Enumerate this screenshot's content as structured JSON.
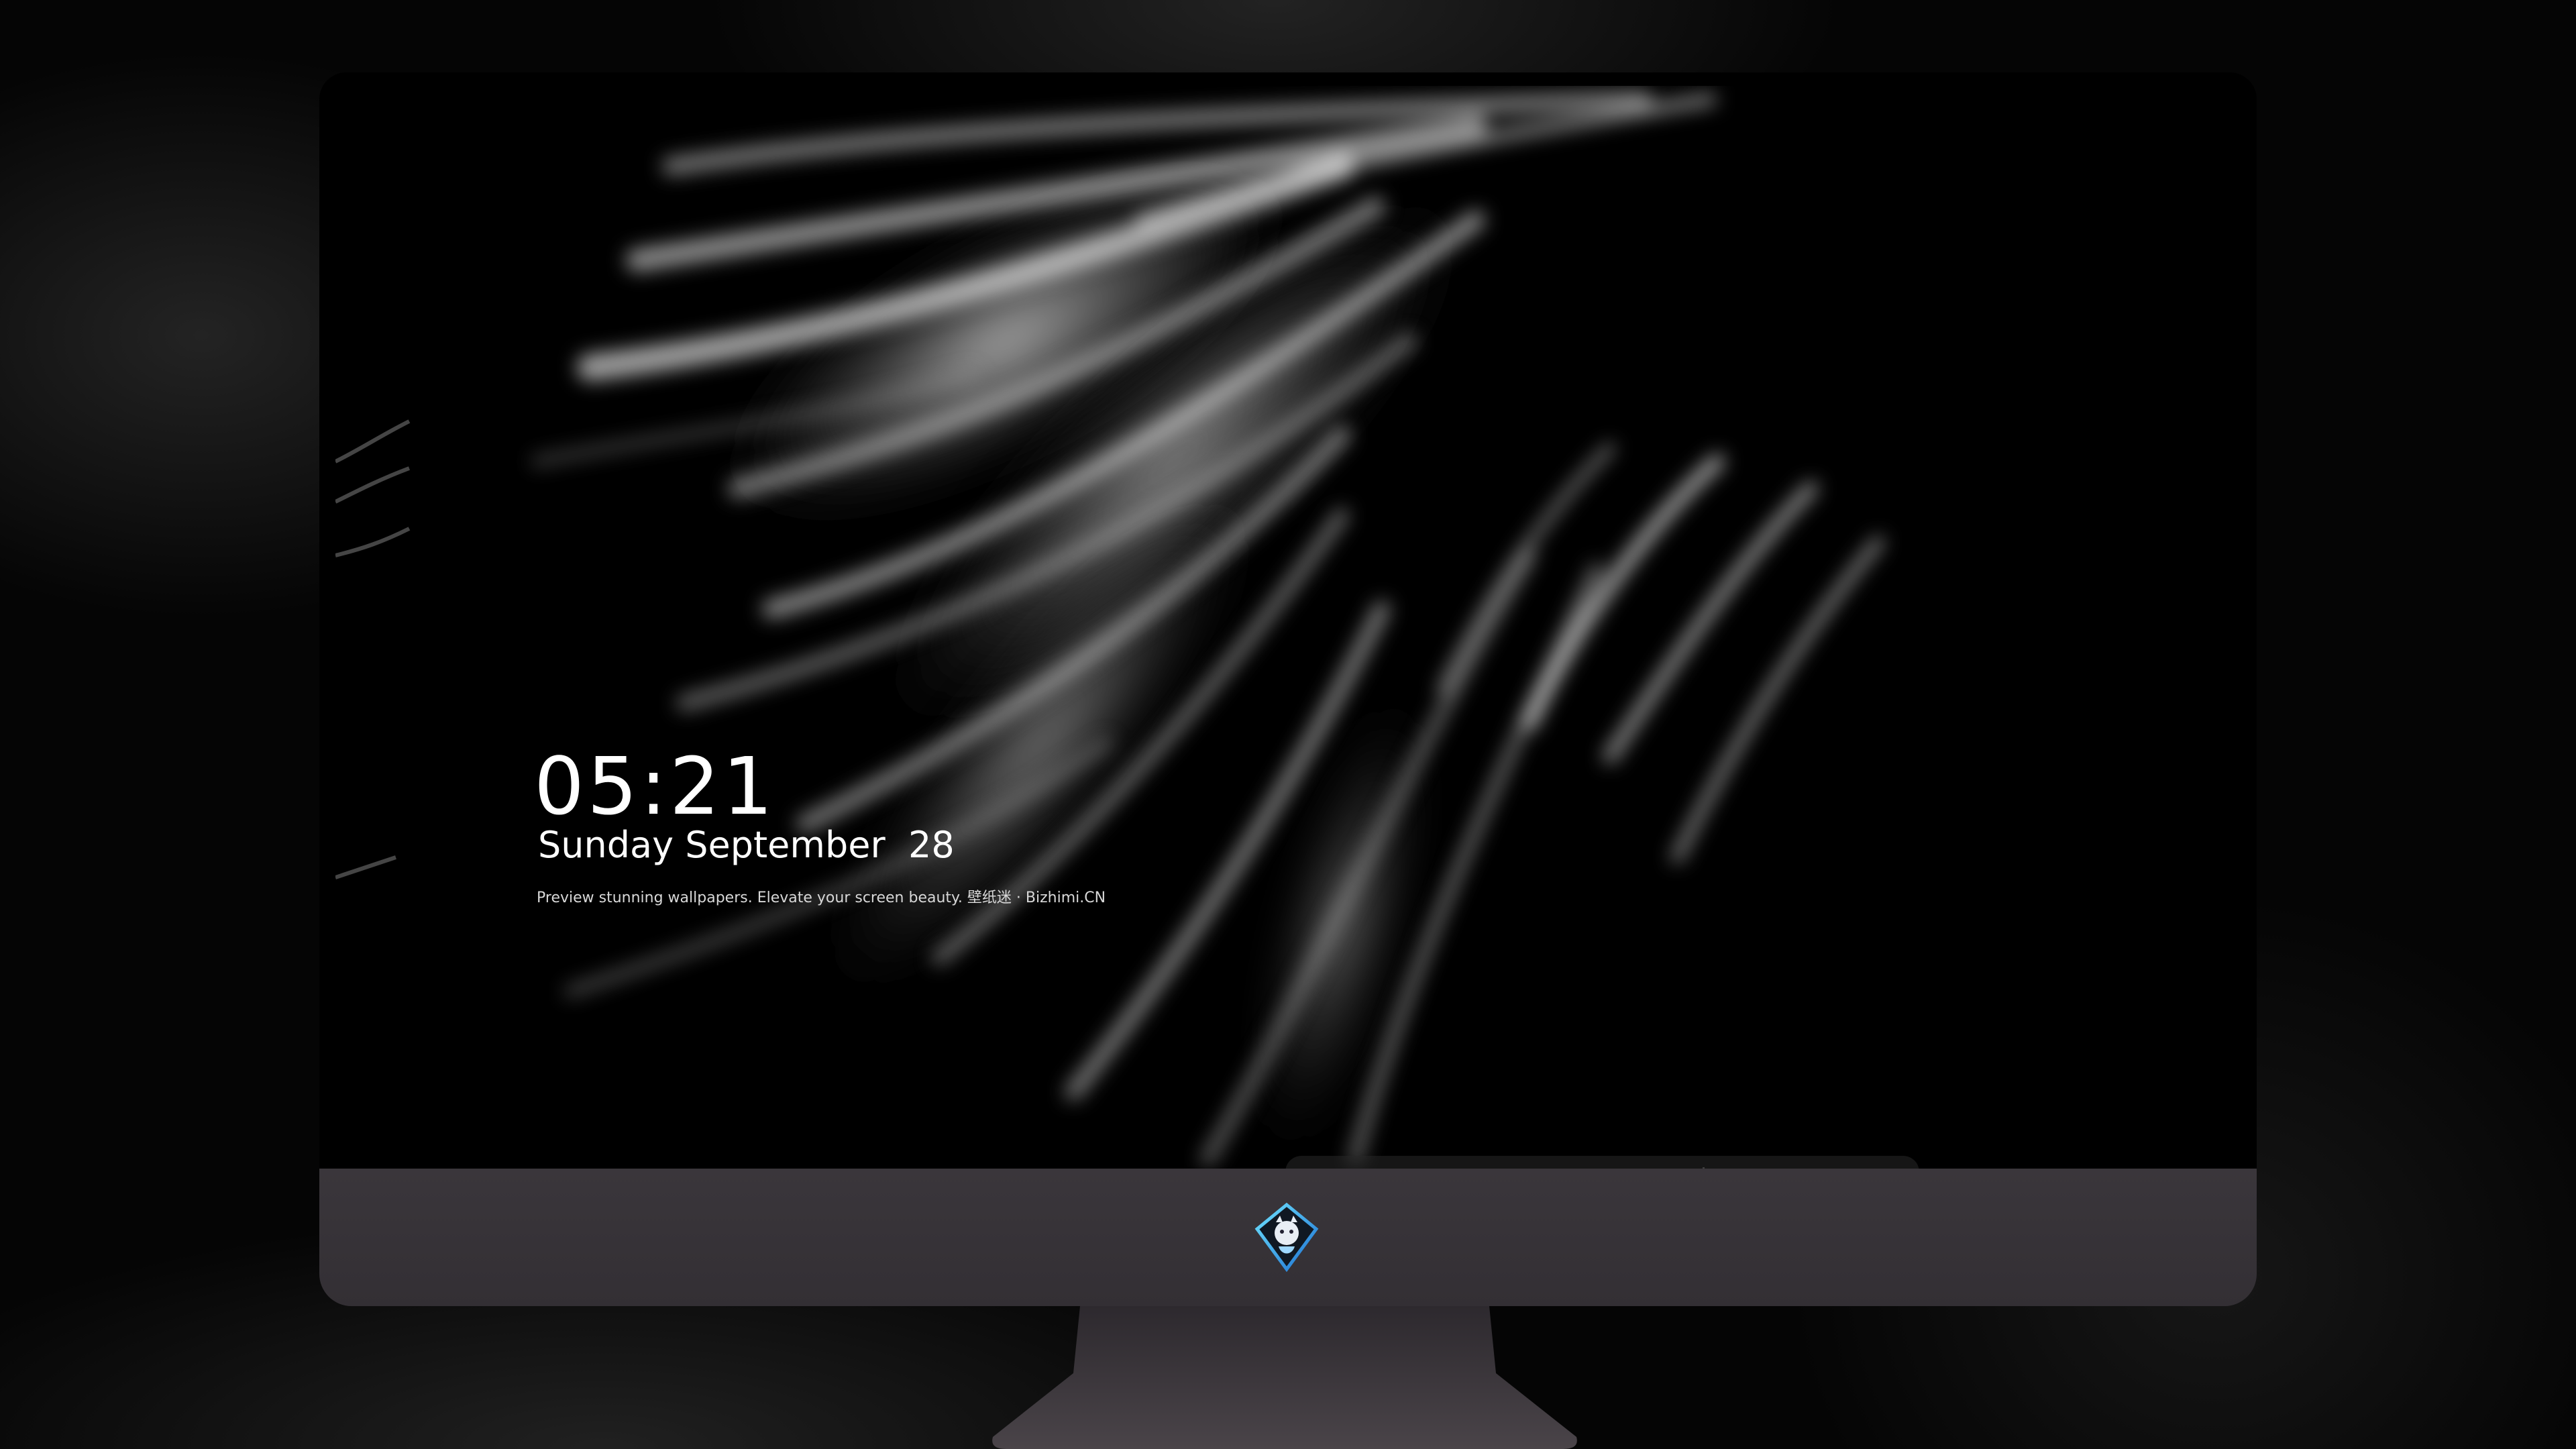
{
  "lockscreen": {
    "time": "05:21",
    "date": "Sunday September  28",
    "tagline": "Preview stunning wallpapers. Elevate your screen beauty. 壁纸迷 · Bizhimi.CN"
  },
  "dock": {
    "apps": [
      {
        "icon": "messages-icon",
        "color": "#34c759"
      },
      {
        "icon": "weather-icon",
        "color": "#2f8ff0"
      },
      {
        "icon": "clock-icon",
        "color": "#ffffff"
      },
      {
        "icon": "preview-icon",
        "color": "#f4c44a"
      },
      {
        "icon": "clips-icon",
        "color": "#4fc3e8"
      },
      {
        "icon": "notes-icon",
        "color": "#ffd84a"
      },
      {
        "icon": "photo-booth-icon",
        "color": "#f0f0f0"
      },
      {
        "icon": "itunes-icon",
        "color": "#e04bd8"
      },
      {
        "icon": "app-store-icon",
        "color": "#1a8cff"
      },
      {
        "icon": "camera-icon",
        "color": "#9a9a9a"
      }
    ]
  },
  "monitor": {
    "chin_color": "#36323a",
    "logo": "bizhimi-logo"
  }
}
